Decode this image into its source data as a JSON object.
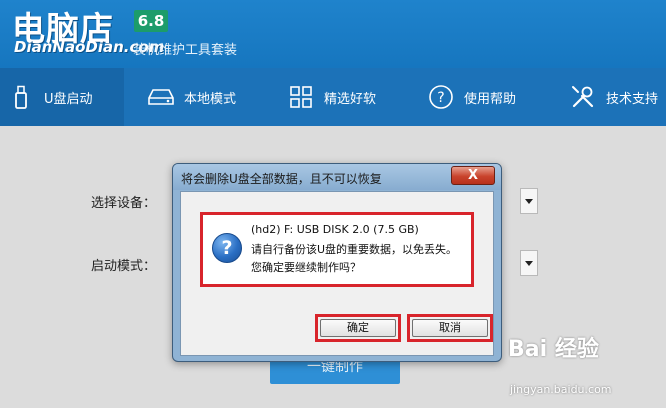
{
  "app": {
    "logo": "电脑店",
    "logo_pinyin": "DianNaoDian.com",
    "version": "6.8",
    "tagline": "装机维护工具套装"
  },
  "nav": {
    "items": [
      {
        "label": "U盘启动",
        "icon": "usb-drive-icon",
        "active": true
      },
      {
        "label": "本地模式",
        "icon": "hard-disk-icon",
        "active": false
      },
      {
        "label": "精选好软",
        "icon": "app-grid-icon",
        "active": false
      },
      {
        "label": "使用帮助",
        "icon": "help-circle-icon",
        "active": false
      },
      {
        "label": "技术支持",
        "icon": "tools-icon",
        "active": false
      }
    ]
  },
  "form": {
    "device_label": "选择设备：",
    "mode_label": "启动模式：",
    "start_button": "一键制作"
  },
  "dialog": {
    "title": "将会删除U盘全部数据，且不可以恢复",
    "close": "X",
    "icon": "question-icon",
    "line1": "(hd2) F: USB DISK 2.0 (7.5 GB)",
    "line2": "请自行备份该U盘的重要数据，以免丢失。",
    "line3": "您确定要继续制作吗？",
    "ok_label": "确定",
    "cancel_label": "取消",
    "highlight_color": "#d8242b"
  },
  "watermark": {
    "brand": "Bai 经验",
    "url": "jingyan.baidu.com"
  }
}
